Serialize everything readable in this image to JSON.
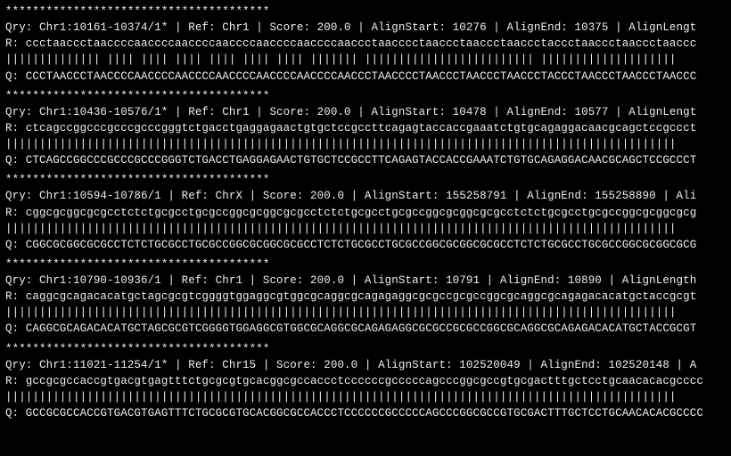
{
  "separator": "***************************************",
  "blocks": [
    {
      "header": "Qry: Chr1:10161-10374/1* | Ref: Chr1 | Score: 200.0 | AlignStart: 10276 | AlignEnd: 10375 | AlignLengt",
      "ref": "R: ccctaaccctaaccccaaccccaaccccaaccccaaccccaaccccaaccctaacccctaaccctaaccctaaccctaccctaaccctaaccctaaccc",
      "match": "   |||||||||||||| |||| |||| |||| |||| |||| |||| ||||||| ||||||||||||||||||||||||| ||||||||||||||||||||",
      "qry": "Q: CCCTAACCCTAACCCCAACCCCAACCCCAACCCCAACCCCAACCCCAACCCTAACCCCTAACCCTAACCCTAACCCTACCCTAACCCTAACCCTAACCC"
    },
    {
      "header": "Qry: Chr1:10436-10576/1* | Ref: Chr1 | Score: 200.0 | AlignStart: 10478 | AlignEnd: 10577 | AlignLengt",
      "ref": "R: ctcagccggcccgcccgcccgggtctgacctgaggagaactgtgctccgccttcagagtaccaccgaaatctgtgcagaggacaacgcagctccgccct",
      "match": "   |||||||||||||||||||||||||||||||||||||||||||||||||||||||||||||||||||||||||||||||||||||||||||||||||||",
      "qry": "Q: CTCAGCCGGCCCGCCCGCCCGGGTCTGACCTGAGGAGAACTGTGCTCCGCCTTCAGAGTACCACCGAAATCTGTGCAGAGGACAACGCAGCTCCGCCCT"
    },
    {
      "header": "Qry: Chr1:10594-10786/1 | Ref: ChrX | Score: 200.0 | AlignStart: 155258791 | AlignEnd: 155258890 | Ali",
      "ref": "R: cggcgcggcgcgcctctctgcgcctgcgccggcgcggcgcgcctctctgcgcctgcgccggcgcggcgcgcctctctgcgcctgcgccggcgcggcgcg",
      "match": "   |||||||||||||||||||||||||||||||||||||||||||||||||||||||||||||||||||||||||||||||||||||||||||||||||||",
      "qry": "Q: CGGCGCGGCGCGCCTCTCTGCGCCTGCGCCGGCGCGGCGCGCCTCTCTGCGCCTGCGCCGGCGCGGCGCGCCTCTCTGCGCCTGCGCCGGCGCGGCGCG"
    },
    {
      "header": "Qry: Chr1:10790-10936/1 | Ref: Chr1 | Score: 200.0 | AlignStart: 10791 | AlignEnd: 10890 | AlignLength",
      "ref": "R: caggcgcagacacatgctagcgcgtcggggtggaggcgtggcgcaggcgcagagaggcgcgccgcgccggcgcaggcgcagagacacatgctaccgcgt",
      "match": "   |||||||||||||||||||||||||||||||||||||||||||||||||||||||||||||||||||||||||||||||||||||||||||||||||||",
      "qry": "Q: CAGGCGCAGACACATGCTAGCGCGTCGGGGTGGAGGCGTGGCGCAGGCGCAGAGAGGCGCGCCGCGCCGGCGCAGGCGCAGAGACACATGCTACCGCGT"
    },
    {
      "header": "Qry: Chr1:11021-11254/1* | Ref: Chr15 | Score: 200.0 | AlignStart: 102520049 | AlignEnd: 102520148 | A",
      "ref": "R: gccgcgccaccgtgacgtgagtttctgcgcgtgcacggcgccaccctccccccgcccccagcccggcgccgtgcgactttgctcctgcaacacacgcccc",
      "match": "   |||||||||||||||||||||||||||||||||||||||||||||||||||||||||||||||||||||||||||||||||||||||||||||||||||",
      "qry": "Q: GCCGCGCCACCGTGACGTGAGTTTCTGCGCGTGCACGGCGCCACCCTCCCCCCGCCCCCAGCCCGGCGCCGTGCGACTTTGCTCCTGCAACACACGCCCC"
    }
  ]
}
